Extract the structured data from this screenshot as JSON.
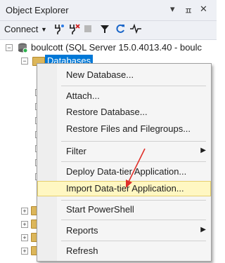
{
  "window": {
    "title": "Object Explorer",
    "controls": [
      "▾",
      "ㅍ",
      "✕"
    ]
  },
  "toolbar": {
    "connect_label": "Connect",
    "icons": [
      "connect-dropdown-icon",
      "connect-plug-icon",
      "disconnect-icon",
      "stop-icon",
      "filter-icon",
      "refresh-icon",
      "activity-monitor-icon"
    ]
  },
  "tree": {
    "server": "boulcott (SQL Server 15.0.4013.40 - boulc",
    "databases": "Databases"
  },
  "context_menu": {
    "items": [
      {
        "label": "New Database..."
      },
      {
        "label": "Attach..."
      },
      {
        "label": "Restore Database..."
      },
      {
        "label": "Restore Files and Filegroups..."
      },
      {
        "label": "Filter",
        "submenu": true
      },
      {
        "label": "Deploy Data-tier Application..."
      },
      {
        "label": "Import Data-tier Application...",
        "highlighted": true
      },
      {
        "label": "Start PowerShell"
      },
      {
        "label": "Reports",
        "submenu": true
      },
      {
        "label": "Refresh"
      }
    ]
  },
  "colors": {
    "selection": "#0078d7",
    "annotation_arrow": "#e0302a",
    "highlight": "#fff7c2"
  }
}
